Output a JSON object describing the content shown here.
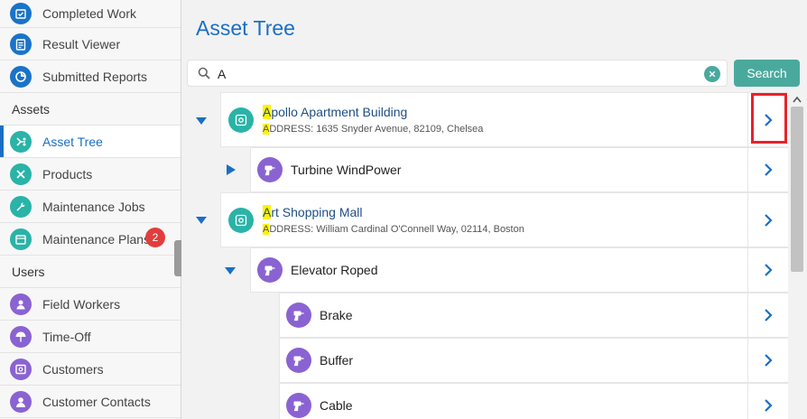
{
  "sidebar": {
    "items_top": [
      {
        "label": "Completed Work",
        "icon": "calendar-check-icon"
      },
      {
        "label": "Result Viewer",
        "icon": "clipboard-icon"
      },
      {
        "label": "Submitted Reports",
        "icon": "pie-chart-icon"
      }
    ],
    "section_assets": "Assets",
    "items_assets": [
      {
        "label": "Asset Tree",
        "icon": "tree-icon"
      },
      {
        "label": "Products",
        "icon": "tools-icon"
      },
      {
        "label": "Maintenance Jobs",
        "icon": "wrench-icon"
      },
      {
        "label": "Maintenance Plans",
        "icon": "calendar-plan-icon",
        "badge": "2"
      }
    ],
    "section_users": "Users",
    "items_users": [
      {
        "label": "Field Workers",
        "icon": "worker-icon"
      },
      {
        "label": "Time-Off",
        "icon": "beach-umbrella-icon"
      },
      {
        "label": "Customers",
        "icon": "contact-card-icon"
      },
      {
        "label": "Customer Contacts",
        "icon": "person-icon"
      }
    ]
  },
  "main": {
    "title": "Asset Tree",
    "search": {
      "value": "A",
      "placeholder": "",
      "button_label": "Search"
    },
    "tree": [
      {
        "hl": "A",
        "title_rest": "pollo Apartment Building",
        "sub_hl": "A",
        "sub_rest": "DDRESS: 1635 Snyder Avenue, 82109, Chelsea"
      },
      {
        "title": "Turbine WindPower"
      },
      {
        "hl": "A",
        "title_rest": "rt Shopping Mall",
        "sub_hl": "A",
        "sub_rest": "DDRESS: William Cardinal O'Connell Way, 02114, Boston"
      },
      {
        "title": "Elevator Roped"
      },
      {
        "title": "Brake"
      },
      {
        "title": "Buffer"
      },
      {
        "title": "Cable"
      }
    ]
  },
  "colors": {
    "accent": "#1a6fc4",
    "teal": "#2ab3a7",
    "purple": "#8a63d2",
    "badge": "#e23d3d",
    "highlight": "#fff200",
    "callout": "#e8222a"
  }
}
